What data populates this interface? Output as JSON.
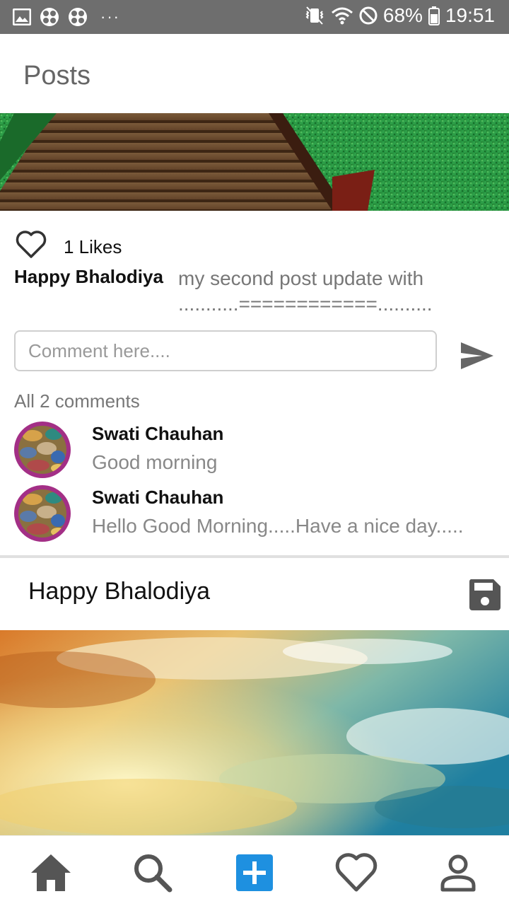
{
  "status_bar": {
    "battery": "68%",
    "time": "19:51",
    "dots": "···",
    "colors": {
      "background": "#6e6e6e"
    }
  },
  "app_bar": {
    "title": "Posts"
  },
  "post1": {
    "image": "wooden-boardwalk-over-grass",
    "likes": "1 Likes",
    "author": "Happy Bhalodiya",
    "caption": "my second  post update with ...........============..........",
    "comment_placeholder": "Comment here....",
    "comments_count_label": "All 2 comments",
    "comments": [
      {
        "name": "Swati Chauhan",
        "text": "Good morning"
      },
      {
        "name": "Swati Chauhan",
        "text": "Hello Good Morning.....Have a nice day....."
      }
    ]
  },
  "post2": {
    "author": "Happy Bhalodiya",
    "image": "sunset-sky-clouds"
  },
  "bottom_nav": {
    "items": [
      "home-icon",
      "search-icon",
      "add-post-icon",
      "heart-icon",
      "profile-icon"
    ],
    "accent_color": "#1e90e0"
  }
}
